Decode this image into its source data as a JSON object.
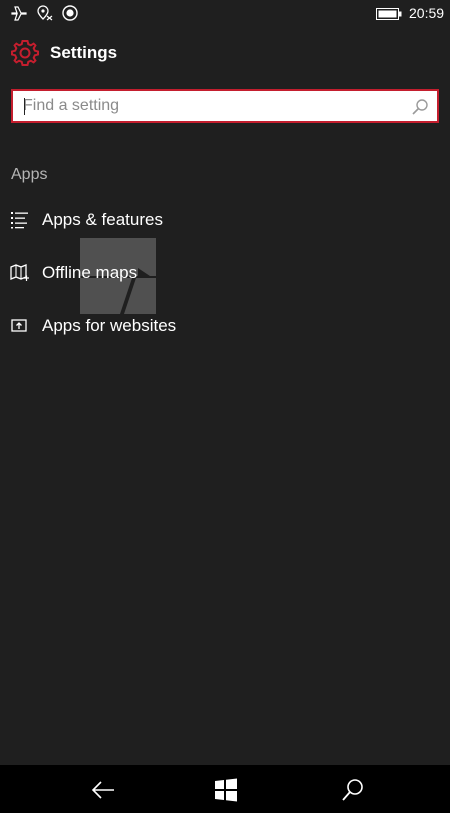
{
  "status_bar": {
    "time": "20:59",
    "icons": [
      "airplane-mode-icon",
      "location-icon",
      "driving-mode-icon",
      "battery-icon"
    ]
  },
  "header": {
    "title": "Settings",
    "icon": "gear-icon",
    "accent_color": "#c41e2e"
  },
  "search": {
    "placeholder": "Find a setting",
    "value": "",
    "icon": "search-icon"
  },
  "section": {
    "heading": "Apps",
    "items": [
      {
        "label": "Apps & features",
        "icon": "list-icon"
      },
      {
        "label": "Offline maps",
        "icon": "map-icon"
      },
      {
        "label": "Apps for websites",
        "icon": "window-link-icon"
      }
    ]
  },
  "nav_bar": {
    "buttons": [
      "back-arrow-icon",
      "windows-logo-icon",
      "search-icon"
    ]
  },
  "colors": {
    "background": "#1f1f1f",
    "nav_background": "#000000",
    "accent": "#c41e2e"
  }
}
